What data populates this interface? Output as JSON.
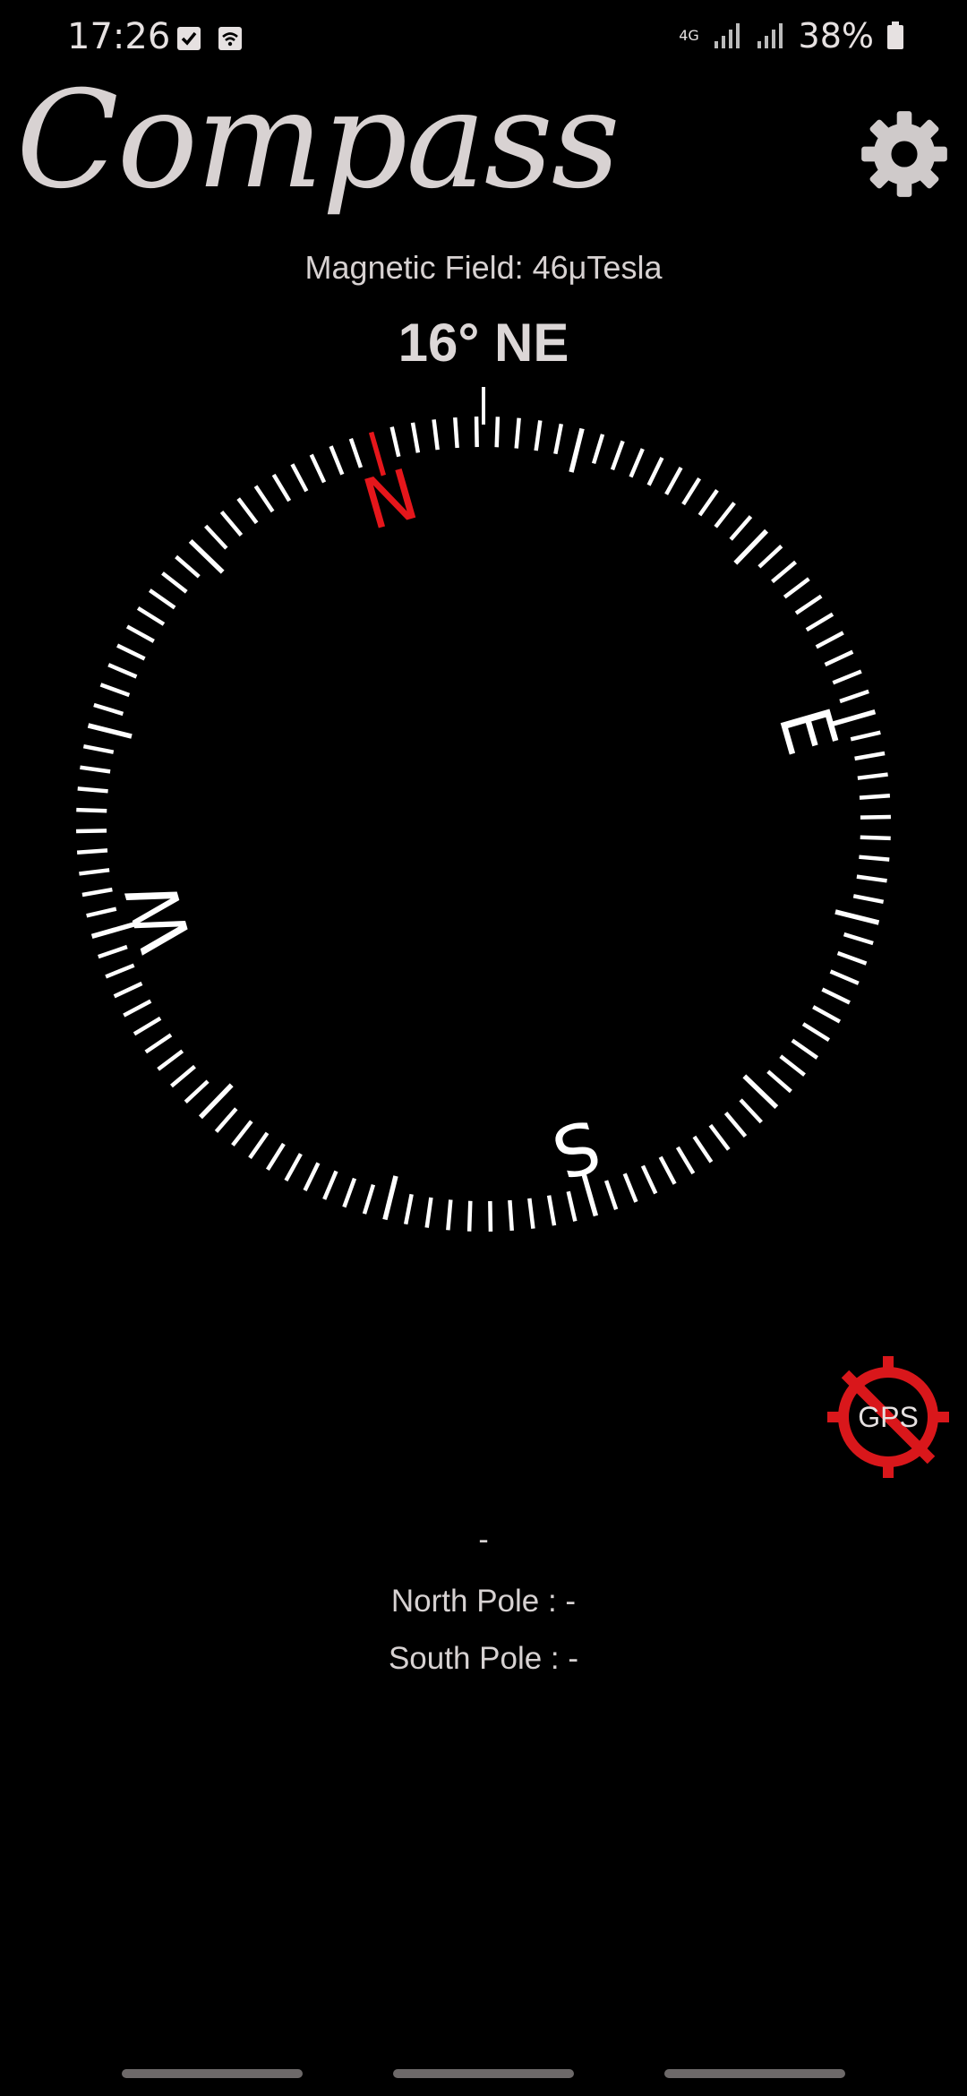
{
  "status_bar": {
    "time": "17:26",
    "battery": "38%",
    "network_label": "4G",
    "icons": [
      "checkbox-icon",
      "wifi-icon",
      "signal-icon",
      "signal-icon",
      "battery-icon"
    ]
  },
  "header": {
    "title": "Compass",
    "settings_icon": "gear-icon"
  },
  "readings": {
    "magnetic_field": "Magnetic Field: 46μTesla",
    "heading": "16° NE",
    "heading_degrees": 16
  },
  "compass": {
    "cardinals": {
      "north": "N",
      "east": "E",
      "south": "S",
      "west": "W"
    },
    "north_color": "#e5161b",
    "tick_color": "#ffffff"
  },
  "gps": {
    "label": "GPS",
    "status": "disabled",
    "color": "#d9171b"
  },
  "location": {
    "value": "-",
    "north_pole": "North Pole : -",
    "south_pole": "South Pole : -"
  }
}
